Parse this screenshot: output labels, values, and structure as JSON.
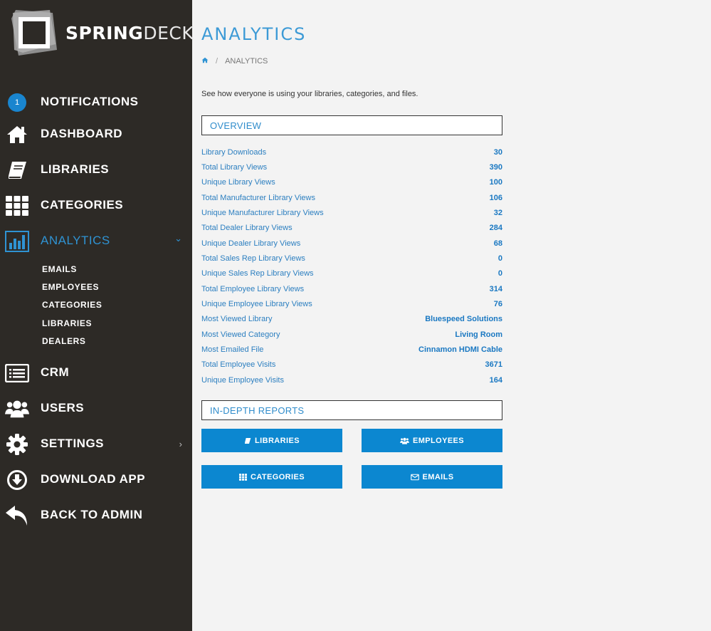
{
  "brand": {
    "strong": "SPRING",
    "light": "DECK"
  },
  "sidebar": {
    "notifications": {
      "label": "NOTIFICATIONS",
      "count": "1"
    },
    "items": [
      {
        "label": "DASHBOARD",
        "icon": "home-icon"
      },
      {
        "label": "LIBRARIES",
        "icon": "book-icon"
      },
      {
        "label": "CATEGORIES",
        "icon": "grid-icon"
      },
      {
        "label": "ANALYTICS",
        "icon": "bar-chart-icon"
      },
      {
        "label": "CRM",
        "icon": "list-icon"
      },
      {
        "label": "USERS",
        "icon": "users-icon"
      },
      {
        "label": "SETTINGS",
        "icon": "gear-icon"
      },
      {
        "label": "DOWNLOAD APP",
        "icon": "download-icon"
      },
      {
        "label": "BACK TO ADMIN",
        "icon": "reply-icon"
      }
    ],
    "analytics_sub": [
      "EMAILS",
      "EMPLOYEES",
      "CATEGORIES",
      "LIBRARIES",
      "DEALERS"
    ]
  },
  "page": {
    "title": "ANALYTICS",
    "breadcrumb_current": "ANALYTICS",
    "intro": "See how everyone is using your libraries, categories, and files."
  },
  "overview": {
    "heading": "OVERVIEW",
    "rows": [
      {
        "label": "Library Downloads",
        "value": "30"
      },
      {
        "label": "Total Library Views",
        "value": "390"
      },
      {
        "label": "Unique Library Views",
        "value": "100"
      },
      {
        "label": "Total Manufacturer Library Views",
        "value": "106"
      },
      {
        "label": "Unique Manufacturer Library Views",
        "value": "32"
      },
      {
        "label": "Total Dealer Library Views",
        "value": "284"
      },
      {
        "label": "Unique Dealer Library Views",
        "value": "68"
      },
      {
        "label": "Total Sales Rep Library Views",
        "value": "0"
      },
      {
        "label": "Unique Sales Rep Library Views",
        "value": "0"
      },
      {
        "label": "Total Employee Library Views",
        "value": "314"
      },
      {
        "label": "Unique Employee Library Views",
        "value": "76"
      },
      {
        "label": "Most Viewed Library",
        "value": "Bluespeed Solutions"
      },
      {
        "label": "Most Viewed Category",
        "value": "Living Room"
      },
      {
        "label": "Most Emailed File",
        "value": "Cinnamon HDMI Cable"
      },
      {
        "label": "Total Employee Visits",
        "value": "3671"
      },
      {
        "label": "Unique Employee Visits",
        "value": "164"
      }
    ]
  },
  "reports": {
    "heading": "IN-DEPTH REPORTS",
    "buttons": [
      {
        "label": "LIBRARIES",
        "icon": "book-icon"
      },
      {
        "label": "EMPLOYEES",
        "icon": "users-icon"
      },
      {
        "label": "CATEGORIES",
        "icon": "grid-icon"
      },
      {
        "label": "EMAILS",
        "icon": "envelope-icon"
      }
    ]
  },
  "colors": {
    "sidebar_bg": "#2d2a26",
    "accent": "#2f93d3",
    "button": "#0c87d0"
  }
}
